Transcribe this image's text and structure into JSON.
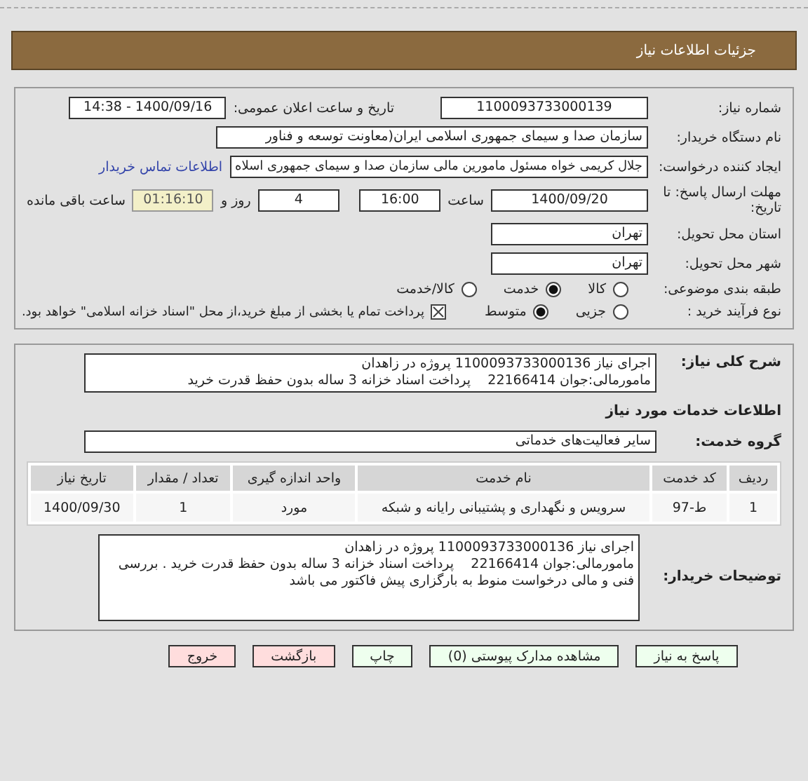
{
  "header": {
    "title": "جزئیات اطلاعات نیاز"
  },
  "details": {
    "need_number": {
      "label": "شماره نیاز:",
      "value": "1100093733000139"
    },
    "announce": {
      "label": "تاریخ و ساعت اعلان عمومی:",
      "value": "1400/09/16 - 14:38"
    },
    "buyer": {
      "label": "نام دستگاه خریدار:",
      "value": "سازمان صدا و سیمای جمهوری اسلامی ایران(معاونت توسعه و فناور"
    },
    "creator": {
      "label": "ایجاد کننده درخواست:",
      "value": "جلال کریمی خواه مسئول مامورین مالی  سازمان صدا و سیمای جمهوری اسلاه",
      "link": "اطلاعات تماس خریدار"
    },
    "deadline": {
      "label": "مهلت ارسال پاسخ: تا تاریخ:",
      "date": "1400/09/20",
      "time_label": "ساعت",
      "time": "16:00",
      "days": "4",
      "days_label": "روز و",
      "remaining": "01:16:10",
      "remaining_label": "ساعت باقی مانده"
    },
    "province": {
      "label": "استان محل تحویل:",
      "value": "تهران"
    },
    "city": {
      "label": "شهر محل تحویل:",
      "value": "تهران"
    },
    "category": {
      "label": "طبقه بندی موضوعی:",
      "options": [
        {
          "label": "کالا",
          "selected": false
        },
        {
          "label": "خدمت",
          "selected": true
        },
        {
          "label": "کالا/خدمت",
          "selected": false
        }
      ]
    },
    "process": {
      "label": "نوع فرآیند خرید :",
      "options": [
        {
          "label": "جزیی",
          "selected": false
        },
        {
          "label": "متوسط",
          "selected": true
        }
      ],
      "treasury": {
        "checked": true,
        "label": "پرداخت تمام یا بخشی از مبلغ خرید،از محل \"اسناد خزانه اسلامی\" خواهد بود."
      }
    }
  },
  "description": {
    "label": "شرح کلی نیاز:",
    "lines": [
      "اجرای نیاز 1100093733000136 پروژه در زاهدان",
      "مامورمالی:جوان 22166414    پرداخت اسناد خزانه 3 ساله بدون حفظ قدرت خرید"
    ]
  },
  "services_heading": "اطلاعات خدمات مورد نیاز",
  "service_group": {
    "label": "گروه خدمت:",
    "value": "سایر فعالیت‌های خدماتی"
  },
  "table": {
    "columns": [
      "ردیف",
      "کد خدمت",
      "نام خدمت",
      "واحد اندازه گیری",
      "تعداد / مقدار",
      "تاریخ نیاز"
    ],
    "rows": [
      [
        "1",
        "ط-97",
        "سرویس و نگهداری و پشتیبانی رایانه و شبکه",
        "مورد",
        "1",
        "1400/09/30"
      ]
    ]
  },
  "buyer_notes": {
    "label": "توضیحات خریدار:",
    "text": "اجرای نیاز 1100093733000136 پروژه در زاهدان\nمامورمالی:جوان 22166414    پرداخت اسناد خزانه 3 ساله بدون حفظ قدرت خرید . بررسی فنی و مالی درخواست منوط به بارگزاری پیش فاکتور می باشد"
  },
  "buttons": [
    {
      "label": "پاسخ به نیاز",
      "color": "#eeffee"
    },
    {
      "label": "مشاهده مدارک پیوستی (0)",
      "color": "#eeffee"
    },
    {
      "label": "چاپ",
      "color": "#eeffee"
    },
    {
      "label": "بازگشت",
      "color": "#ffdddd"
    },
    {
      "label": "خروج",
      "color": "#ffdddd"
    }
  ]
}
